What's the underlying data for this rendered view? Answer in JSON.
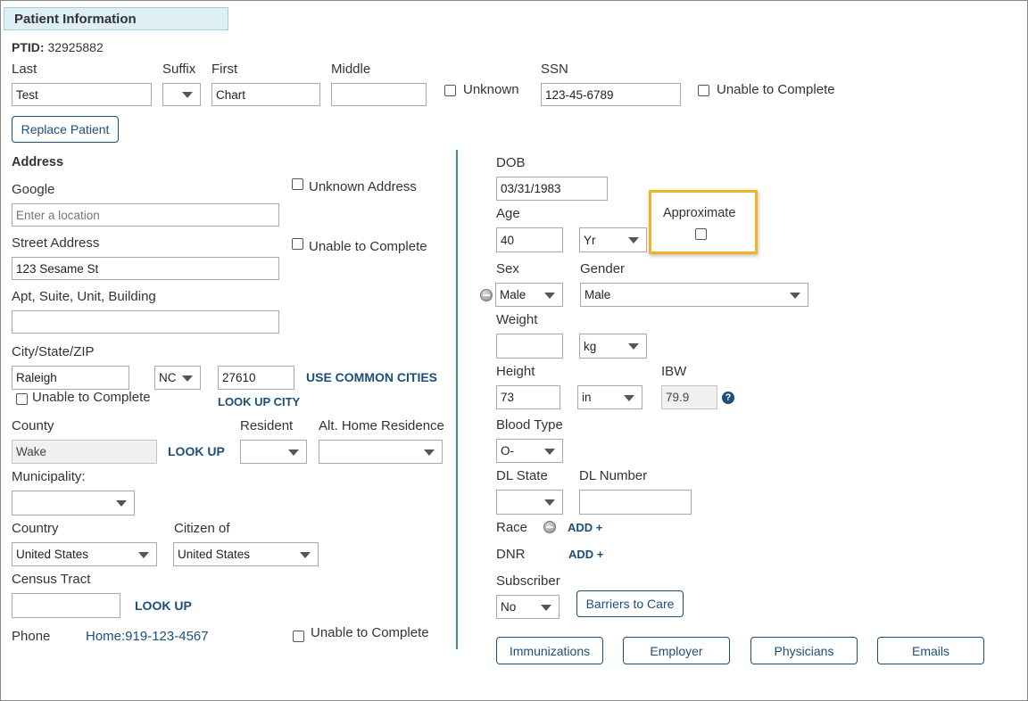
{
  "header": {
    "title": "Patient Information"
  },
  "ptid": {
    "label": "PTID:",
    "value": "32925882"
  },
  "name": {
    "last_label": "Last",
    "last_value": "Test",
    "suffix_label": "Suffix",
    "suffix_value": "",
    "first_label": "First",
    "first_value": "Chart",
    "middle_label": "Middle",
    "middle_value": "",
    "unknown_label": "Unknown",
    "ssn_label": "SSN",
    "ssn_value": "123-45-6789",
    "ssn_unable_label": "Unable to Complete"
  },
  "replace_patient_label": "Replace Patient",
  "address": {
    "title": "Address",
    "google_label": "Google",
    "google_placeholder": "Enter a location",
    "unknown_address_label": "Unknown Address",
    "street_label": "Street Address",
    "street_value": "123 Sesame St",
    "street_unable_label": "Unable to Complete",
    "apt_label": "Apt, Suite, Unit, Building",
    "apt_value": "",
    "csz_label": "City/State/ZIP",
    "city_value": "Raleigh",
    "state_value": "NC",
    "zip_value": "27610",
    "use_common_cities": "USE COMMON CITIES",
    "look_up_city": "LOOK UP CITY",
    "city_unable_label": "Unable to Complete",
    "county_label": "County",
    "county_value": "Wake",
    "county_lookup": "LOOK UP",
    "resident_label": "Resident",
    "alt_home_label": "Alt. Home Residence",
    "municipality_label": "Municipality:",
    "country_label": "Country",
    "country_value": "United States",
    "citizen_label": "Citizen of",
    "citizen_value": "United States",
    "census_label": "Census Tract",
    "census_lookup": "LOOK UP",
    "phone_label": "Phone",
    "phone_value": "Home:919-123-4567",
    "phone_unable_label": "Unable to Complete"
  },
  "demo": {
    "dob_label": "DOB",
    "dob_value": "03/31/1983",
    "age_label": "Age",
    "age_value": "40",
    "age_unit": "Yr",
    "approximate_label": "Approximate",
    "sex_label": "Sex",
    "sex_value": "Male",
    "gender_label": "Gender",
    "gender_value": "Male",
    "weight_label": "Weight",
    "weight_value": "",
    "weight_unit": "kg",
    "height_label": "Height",
    "height_value": "73",
    "height_unit": "in",
    "ibw_label": "IBW",
    "ibw_value": "79.9",
    "blood_label": "Blood Type",
    "blood_value": "O-",
    "dl_state_label": "DL State",
    "dl_number_label": "DL Number",
    "race_label": "Race",
    "race_add": "ADD +",
    "dnr_label": "DNR",
    "dnr_add": "ADD +",
    "subscriber_label": "Subscriber",
    "subscriber_value": "No",
    "barriers_label": "Barriers to Care"
  },
  "bottom_buttons": {
    "immunizations": "Immunizations",
    "employer": "Employer",
    "physicians": "Physicians",
    "emails": "Emails"
  },
  "colors": {
    "accent": "#1b4f7a",
    "divider": "#3a8fa5",
    "highlight": "#f5b324",
    "header_bg": "#ddeef5"
  }
}
